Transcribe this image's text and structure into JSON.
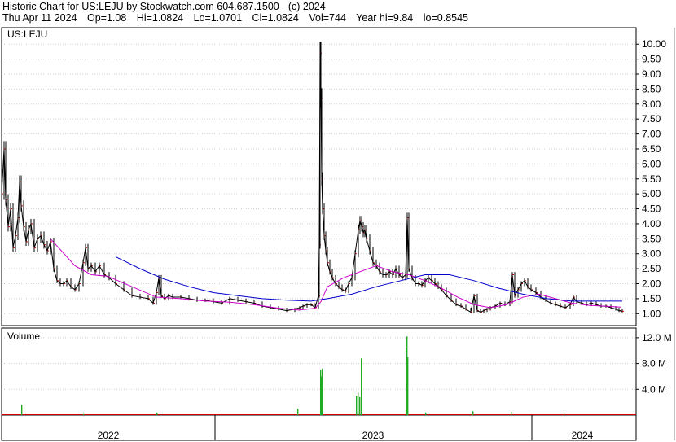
{
  "header": {
    "title": "Historic Chart for US:LEJU by Stockwatch.com 604.687.1500 - (c) 2024",
    "date": "Thu Apr 11 2024",
    "open": "Op=1.08",
    "high": "Hi=1.0824",
    "low": "Lo=1.0701",
    "close": "Cl=1.0824",
    "volume": "Vol=744",
    "year_high": "Year hi=9.84",
    "year_low": "lo=0.8545"
  },
  "chart_data": [
    {
      "type": "line",
      "title": "US:LEJU",
      "ylim": [
        0.6,
        10.55
      ],
      "y_ticks": [
        "10.00",
        "9.50",
        "9.00",
        "8.50",
        "8.00",
        "7.50",
        "7.00",
        "6.50",
        "6.00",
        "5.50",
        "5.00",
        "4.50",
        "4.00",
        "3.50",
        "3.00",
        "2.50",
        "2.00",
        "1.50",
        "1.00"
      ],
      "y_tick_values": [
        10.0,
        9.5,
        9.0,
        8.5,
        8.0,
        7.5,
        7.0,
        6.5,
        6.0,
        5.5,
        5.0,
        4.5,
        4.0,
        3.5,
        3.0,
        2.5,
        2.0,
        1.5,
        1.0
      ],
      "x_labels": [
        "2022",
        "2023",
        "2024"
      ],
      "colors": {
        "price": "#000000",
        "ma_short": "#cc00cc",
        "ma_long": "#0000cc",
        "close_tick": "#cc0000"
      },
      "series": [
        {
          "role": "price",
          "x": [
            0,
            3,
            5,
            8,
            11,
            14,
            17,
            20,
            22,
            24,
            27,
            30,
            33,
            36,
            40,
            44,
            48,
            52,
            56,
            60,
            64,
            68,
            72,
            76,
            80,
            85,
            90,
            95,
            100,
            103,
            106,
            110,
            115,
            120,
            126,
            132,
            140,
            150,
            160,
            170,
            180,
            186,
            190,
            193,
            196,
            200,
            205,
            210,
            220,
            230,
            240,
            250,
            260,
            270,
            280,
            290,
            300,
            310,
            320,
            330,
            340,
            350,
            360,
            366,
            370,
            375,
            380,
            385,
            389,
            390,
            391,
            392,
            393,
            394,
            396,
            398,
            400,
            403,
            406,
            410,
            414,
            418,
            422,
            426,
            430,
            434,
            438,
            440,
            442,
            444,
            446,
            448,
            452,
            456,
            460,
            464,
            468,
            472,
            476,
            480,
            484,
            488,
            492,
            496,
            498,
            500,
            504,
            508,
            512,
            516,
            520,
            524,
            528,
            532,
            536,
            540,
            546,
            552,
            558,
            564,
            570,
            576,
            580,
            584,
            588,
            592,
            596,
            600,
            606,
            612,
            618,
            624,
            627,
            630,
            634,
            638,
            642,
            646,
            650,
            656,
            662,
            668,
            674,
            680,
            686,
            692,
            698,
            702,
            706,
            712,
            718,
            724,
            730,
            736,
            742,
            748,
            754,
            758,
            762
          ],
          "values": [
            5.0,
            6.5,
            4.8,
            3.9,
            4.5,
            3.2,
            3.6,
            4.2,
            5.4,
            4.6,
            3.9,
            3.4,
            3.8,
            4.0,
            3.2,
            3.5,
            3.6,
            3.3,
            3.1,
            3.4,
            2.5,
            2.1,
            2.0,
            2.0,
            2.1,
            1.9,
            1.8,
            2.0,
            2.7,
            3.2,
            2.5,
            2.6,
            2.4,
            2.6,
            2.3,
            2.2,
            2.0,
            1.8,
            1.6,
            1.55,
            1.5,
            1.35,
            1.7,
            2.2,
            1.6,
            1.5,
            1.6,
            1.55,
            1.55,
            1.5,
            1.45,
            1.45,
            1.4,
            1.35,
            1.5,
            1.45,
            1.4,
            1.35,
            1.25,
            1.2,
            1.15,
            1.1,
            1.15,
            1.2,
            1.25,
            1.3,
            1.3,
            1.2,
            1.6,
            3.3,
            9.7,
            8.2,
            5.5,
            4.5,
            3.6,
            3.1,
            2.7,
            2.4,
            2.2,
            2.0,
            1.9,
            1.8,
            1.75,
            2.0,
            2.2,
            3.0,
            3.8,
            4.1,
            3.9,
            3.7,
            3.8,
            3.5,
            3.1,
            2.7,
            2.6,
            2.4,
            2.3,
            2.3,
            2.4,
            2.3,
            2.5,
            2.3,
            2.2,
            2.3,
            4.2,
            2.5,
            2.2,
            2.0,
            2.0,
            1.95,
            2.1,
            2.2,
            2.1,
            2.0,
            1.9,
            1.8,
            1.6,
            1.45,
            1.3,
            1.25,
            1.15,
            1.05,
            1.6,
            1.1,
            1.05,
            1.1,
            1.15,
            1.2,
            1.25,
            1.35,
            1.3,
            1.4,
            2.3,
            1.6,
            1.8,
            2.0,
            2.1,
            1.9,
            1.8,
            1.7,
            1.55,
            1.45,
            1.35,
            1.3,
            1.25,
            1.2,
            1.3,
            1.55,
            1.4,
            1.35,
            1.3,
            1.35,
            1.3,
            1.25,
            1.25,
            1.2,
            1.15,
            1.1,
            1.08
          ]
        },
        {
          "role": "ma_short",
          "x": [
            60,
            90,
            110,
            130,
            160,
            190,
            220,
            250,
            280,
            310,
            340,
            365,
            385,
            392,
            400,
            420,
            440,
            460,
            480,
            500,
            520,
            540,
            560,
            580,
            600,
            620,
            640,
            660,
            680,
            700,
            720,
            740,
            760
          ],
          "values": [
            3.5,
            2.6,
            2.3,
            2.25,
            1.9,
            1.55,
            1.5,
            1.42,
            1.38,
            1.3,
            1.18,
            1.12,
            1.18,
            1.4,
            1.9,
            2.2,
            2.4,
            2.6,
            2.4,
            2.3,
            2.1,
            1.85,
            1.55,
            1.3,
            1.2,
            1.3,
            1.55,
            1.65,
            1.5,
            1.35,
            1.28,
            1.25,
            1.22
          ]
        },
        {
          "role": "ma_long",
          "x": [
            140,
            170,
            200,
            230,
            260,
            290,
            320,
            350,
            380,
            400,
            430,
            460,
            490,
            520,
            550,
            580,
            610,
            640,
            670,
            700,
            730,
            762
          ],
          "values": [
            2.9,
            2.5,
            2.15,
            1.9,
            1.7,
            1.6,
            1.5,
            1.45,
            1.42,
            1.5,
            1.65,
            1.9,
            2.1,
            2.3,
            2.3,
            2.1,
            1.85,
            1.65,
            1.5,
            1.42,
            1.42,
            1.42
          ]
        }
      ]
    },
    {
      "type": "bar",
      "title": "Volume",
      "ylim": [
        0,
        13.5
      ],
      "y_ticks": [
        "12.0 M",
        "8.0 M",
        "4.0 M"
      ],
      "y_tick_values": [
        12.0,
        8.0,
        4.0
      ],
      "colors": {
        "bar": "#22aa22",
        "baseline": "#cc0000"
      },
      "bars": {
        "x": [
          24,
          100,
          190,
          363,
          391,
          392,
          393,
          435,
          437,
          439,
          441,
          496,
          497,
          498,
          520,
          578,
          625,
          690
        ],
        "values": [
          1.6,
          0.3,
          0.4,
          1.0,
          7.0,
          6.0,
          7.2,
          3.0,
          3.5,
          2.8,
          8.8,
          10.0,
          12.2,
          9.0,
          0.4,
          0.6,
          0.5,
          0.3
        ]
      }
    }
  ]
}
